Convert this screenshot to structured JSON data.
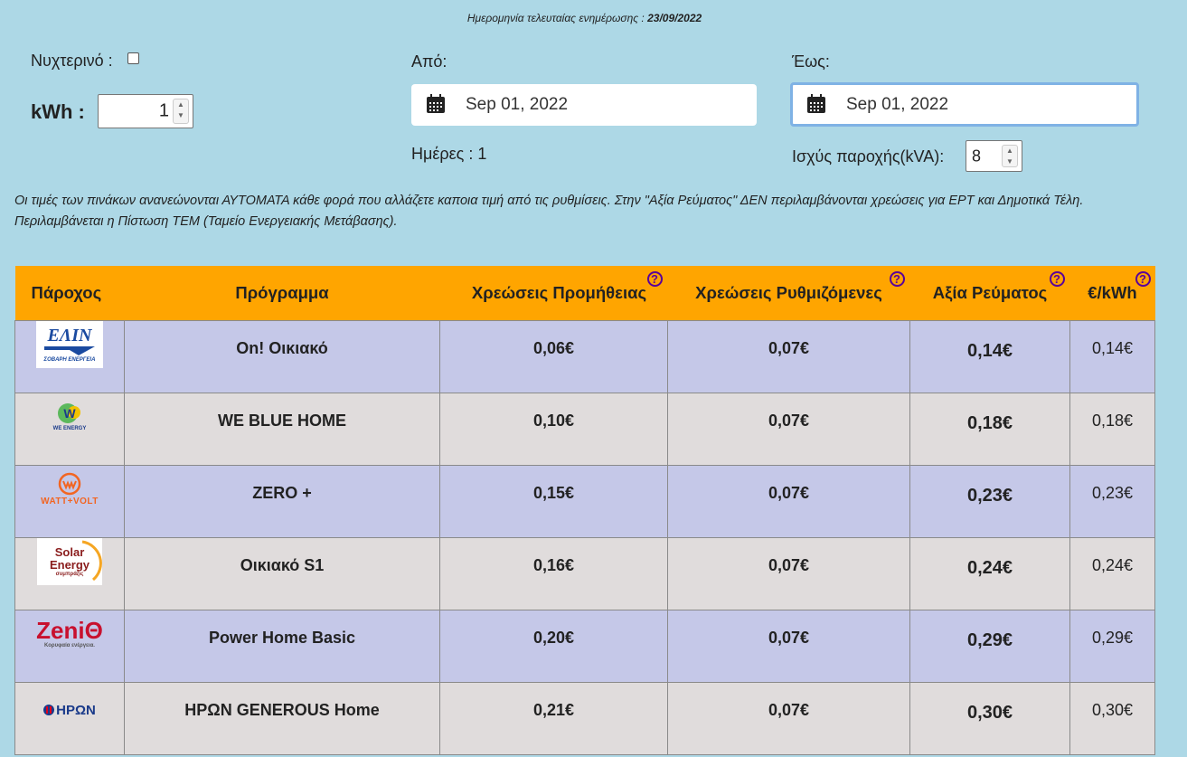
{
  "header": {
    "updated_label": "Ημερομηνία τελευταίας ενημέρωσης :",
    "updated_date": "23/09/2022"
  },
  "controls": {
    "night_label": "Νυχτερινό :",
    "kwh_label": "kWh :",
    "kwh_value": "1",
    "from_label": "Από:",
    "from_date": "Sep 01, 2022",
    "to_label": "Έως:",
    "to_date": "Sep 01, 2022",
    "days_label": "Ημέρες : 1",
    "power_label": "Ισχύς παροχής(kVA):",
    "power_value": "8"
  },
  "note": {
    "line1": "Οι τιμές των πινάκων ανανεώνονται ΑΥΤΟΜΑΤΑ κάθε φορά που αλλάζετε  καποια τιμή από τις ρυθμίσεις.   Στην \"Αξία Ρεύματος\" ΔΕΝ περιλαμβάνονται χρεώσεις για ΕΡΤ και Δημοτικά Τέλη.",
    "line2": "Περιλαμβάνεται η Πίστωση ΤΕΜ (Ταμείο Ενεργειακής Μετάβασης)."
  },
  "table": {
    "headers": {
      "provider": "Πάροχος",
      "program": "Πρόγραμμα",
      "supply": "Χρεώσεις Προμήθειας",
      "regulated": "Χρεώσεις Ρυθμιζόμενες",
      "value": "Αξία Ρεύματος",
      "per_kwh": "€/kWh",
      "help": "?"
    },
    "rows": [
      {
        "logo": "ΕΛΙΝ",
        "logo_sub": "ΣΟΒΑΡΗ ΕΝΕΡΓΕΙΑ",
        "program": "On! Οικιακό",
        "supply": "0,06€",
        "regulated": "0,07€",
        "value": "0,14€",
        "per_kwh": "0,14€"
      },
      {
        "logo": "WE ENERGY",
        "logo_sub": "",
        "program": "WE BLUE HOME",
        "supply": "0,10€",
        "regulated": "0,07€",
        "value": "0,18€",
        "per_kwh": "0,18€"
      },
      {
        "logo": "WATT+VOLT",
        "logo_sub": "",
        "program": "ZERO +",
        "supply": "0,15€",
        "regulated": "0,07€",
        "value": "0,23€",
        "per_kwh": "0,23€"
      },
      {
        "logo": "Solar Energy",
        "logo_sub": "συμπράξις",
        "program": "Οικιακό S1",
        "supply": "0,16€",
        "regulated": "0,07€",
        "value": "0,24€",
        "per_kwh": "0,24€"
      },
      {
        "logo": "ZeniΘ",
        "logo_sub": "Κορυφαία ενέργεια.",
        "program": "Power Home Basic",
        "supply": "0,20€",
        "regulated": "0,07€",
        "value": "0,29€",
        "per_kwh": "0,29€"
      },
      {
        "logo": "ΗΡΩΝ",
        "logo_sub": "",
        "program": "ΗΡΩΝ GENEROUS Home",
        "supply": "0,21€",
        "regulated": "0,07€",
        "value": "0,30€",
        "per_kwh": "0,30€"
      }
    ]
  }
}
